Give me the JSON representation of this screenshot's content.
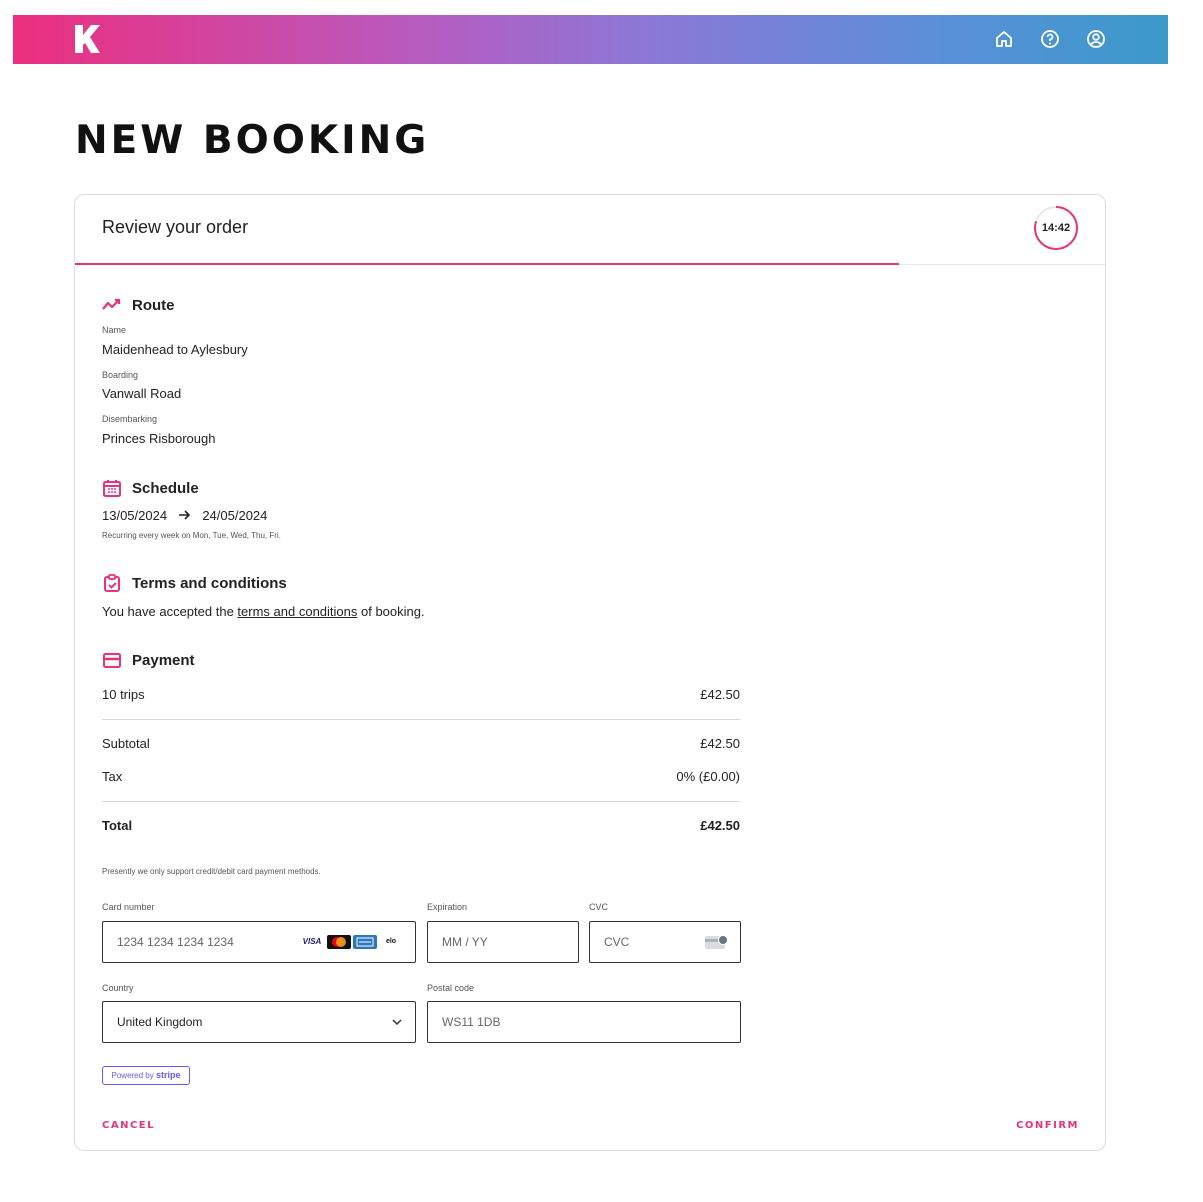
{
  "header": {
    "logo_icon": "k-logo-icon",
    "icons": [
      "home-icon",
      "help-icon",
      "account-icon"
    ]
  },
  "page_title": "NEW BOOKING",
  "card": {
    "title": "Review your order",
    "timer": "14:42",
    "timer_progress": 0.8
  },
  "route": {
    "title": "Route",
    "name_label": "Name",
    "name": "Maidenhead to Aylesbury",
    "boarding_label": "Boarding",
    "boarding": "Vanwall Road",
    "disembarking_label": "Disembarking",
    "disembarking": "Princes Risborough"
  },
  "schedule": {
    "title": "Schedule",
    "start": "13/05/2024",
    "end": "24/05/2024",
    "recurrence": "Recurring every week on Mon, Tue, Wed, Thu, Fri."
  },
  "terms": {
    "title": "Terms and conditions",
    "prefix": "You have accepted the ",
    "link": "terms and conditions",
    "suffix": " of booking."
  },
  "payment": {
    "title": "Payment",
    "line_item": "10 trips",
    "line_amount": "£42.50",
    "subtotal_label": "Subtotal",
    "subtotal": "£42.50",
    "tax_label": "Tax",
    "tax": "0% (£0.00)",
    "total_label": "Total",
    "total": "£42.50",
    "note": "Presently we only support credit/debit card payment methods.",
    "card_number_label": "Card number",
    "card_number_placeholder": "1234 1234 1234 1234",
    "expiration_label": "Expiration",
    "expiration_placeholder": "MM / YY",
    "cvc_label": "CVC",
    "cvc_placeholder": "CVC",
    "country_label": "Country",
    "country": "United Kingdom",
    "postal_label": "Postal code",
    "postal": "WS11 1DB",
    "brands": [
      "VISA",
      "mastercard",
      "amex",
      "elo"
    ],
    "powered_by": "Powered by",
    "stripe": "stripe"
  },
  "actions": {
    "cancel": "CANCEL",
    "confirm": "CONFIRM"
  },
  "colors": {
    "accent": "#e8327a",
    "stripe": "#635bff"
  }
}
